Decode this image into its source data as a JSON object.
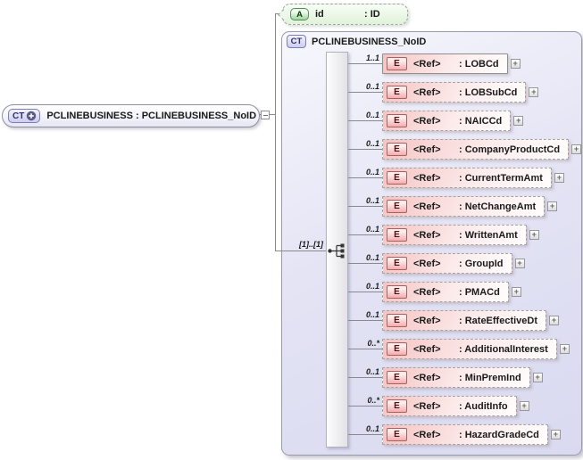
{
  "root_element": {
    "badge": "CT",
    "label": "PCLINEBUSINESS : PCLINEBUSINESS_NoID"
  },
  "attribute": {
    "badge": "A",
    "name": "id",
    "type": ": ID"
  },
  "complex_type": {
    "badge": "CT",
    "title": "PCLINEBUSINESS_NoID",
    "compositor": "sequence",
    "sequence_cardinality": "[1]..[1]"
  },
  "expand_button_label": "+",
  "elements": [
    {
      "cardinality": "1..1",
      "badge": "E",
      "ref": "<Ref>",
      "type": ": LOBCd",
      "required": true
    },
    {
      "cardinality": "0..1",
      "badge": "E",
      "ref": "<Ref>",
      "type": ": LOBSubCd",
      "required": false
    },
    {
      "cardinality": "0..1",
      "badge": "E",
      "ref": "<Ref>",
      "type": ": NAICCd",
      "required": false
    },
    {
      "cardinality": "0..1",
      "badge": "E",
      "ref": "<Ref>",
      "type": ": CompanyProductCd",
      "required": false
    },
    {
      "cardinality": "0..1",
      "badge": "E",
      "ref": "<Ref>",
      "type": ": CurrentTermAmt",
      "required": false
    },
    {
      "cardinality": "0..1",
      "badge": "E",
      "ref": "<Ref>",
      "type": ": NetChangeAmt",
      "required": false
    },
    {
      "cardinality": "0..1",
      "badge": "E",
      "ref": "<Ref>",
      "type": ": WrittenAmt",
      "required": false
    },
    {
      "cardinality": "0..1",
      "badge": "E",
      "ref": "<Ref>",
      "type": ": GroupId",
      "required": false
    },
    {
      "cardinality": "0..1",
      "badge": "E",
      "ref": "<Ref>",
      "type": ": PMACd",
      "required": false
    },
    {
      "cardinality": "0..1",
      "badge": "E",
      "ref": "<Ref>",
      "type": ": RateEffectiveDt",
      "required": false
    },
    {
      "cardinality": "0..*",
      "badge": "E",
      "ref": "<Ref>",
      "type": ": AdditionalInterest",
      "required": false
    },
    {
      "cardinality": "0..1",
      "badge": "E",
      "ref": "<Ref>",
      "type": ": MinPremInd",
      "required": false
    },
    {
      "cardinality": "0..*",
      "badge": "E",
      "ref": "<Ref>",
      "type": ": AuditInfo",
      "required": false
    },
    {
      "cardinality": "0..1",
      "badge": "E",
      "ref": "<Ref>",
      "type": ": HazardGradeCd",
      "required": false
    }
  ],
  "colors": {
    "complex_type_fill": "#e4e4f5",
    "element_fill": "#f5c3c3",
    "attribute_fill": "#e0f2da",
    "connector_line": "#8a8a8a"
  }
}
